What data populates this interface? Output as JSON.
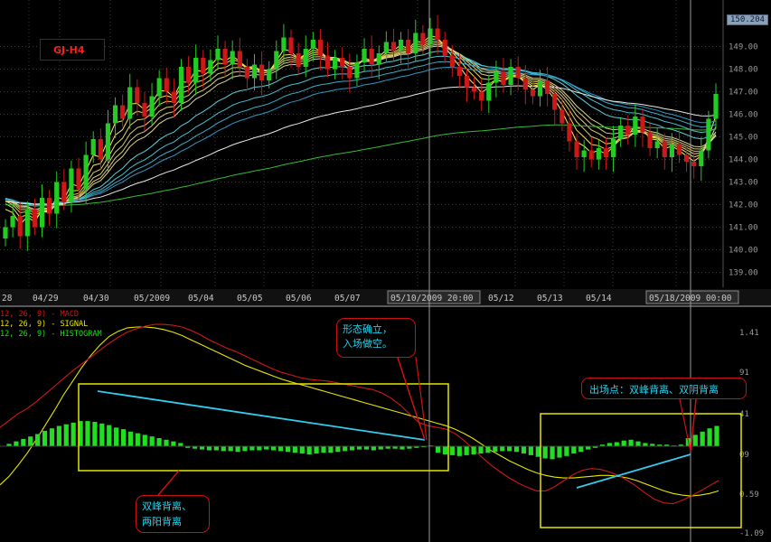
{
  "symbol_label": "GJ-H4",
  "last_price_label": "150.204",
  "price_axis": {
    "ticks": [
      "149.00",
      "148.00",
      "147.00",
      "146.00",
      "145.00",
      "144.00",
      "143.00",
      "142.00",
      "141.00",
      "140.00",
      "139.00"
    ]
  },
  "time_axis": {
    "labels": [
      "28",
      "04/29",
      "04/30",
      "05/2009",
      "05/04",
      "05/05",
      "05/06",
      "05/07",
      "05/10/2009 20:00",
      "05/12",
      "05/13",
      "05/14",
      "05/18/2009 00:00"
    ],
    "highlighted": [
      "05/10/2009 20:00",
      "05/18/2009 00:00"
    ]
  },
  "indicator": {
    "legend": [
      "12, 26, 9) - MACD",
      "12, 26, 9) - SIGNAL",
      "12, 26, 9) - HISTOGRAM"
    ],
    "legend_colors": [
      "#d01818",
      "#e6e600",
      "#22dd22"
    ],
    "axis_ticks": [
      "1.41",
      "91",
      "41",
      "09",
      "0.59",
      "-1.09"
    ]
  },
  "annotations": {
    "entry": [
      "形态确立，",
      "入场做空。"
    ],
    "exit": "出场点：双峰背离、双阴背离",
    "divergence": [
      "双峰背离、",
      "两阳背离"
    ]
  },
  "colors": {
    "up": "#22cc22",
    "down": "#cc1818",
    "grid": "#3a3a3a",
    "macd": "#d01818",
    "signal": "#e6e600",
    "hist": "#22dd22",
    "box": "#e6e600",
    "annotation_text": "#22d3ee",
    "annotation_border": "#cc1111"
  },
  "chart_data": [
    {
      "type": "candlestick",
      "title": "GJ-H4",
      "ylim": [
        138.5,
        150.9
      ],
      "x_labels": [
        "28",
        "04/29",
        "04/30",
        "05/2009",
        "05/04",
        "05/05",
        "05/06",
        "05/07",
        "05/10/2009 20:00",
        "05/12",
        "05/13",
        "05/14",
        "05/18/2009 00:00"
      ],
      "close": [
        141.0,
        141.5,
        140.6,
        141.8,
        141.0,
        142.3,
        141.6,
        143.0,
        142.1,
        143.6,
        142.7,
        144.2,
        144.9,
        144.0,
        145.6,
        146.4,
        145.8,
        147.2,
        146.5,
        145.9,
        146.8,
        147.6,
        147.0,
        146.5,
        148.1,
        147.4,
        148.5,
        147.8,
        148.4,
        148.9,
        148.2,
        148.8,
        148.1,
        147.6,
        148.2,
        147.5,
        148.0,
        148.8,
        149.4,
        148.7,
        148.1,
        148.9,
        149.3,
        148.6,
        148.0,
        148.5,
        148.1,
        147.6,
        148.3,
        148.9,
        148.2,
        148.7,
        149.2,
        148.8,
        149.3,
        148.7,
        149.6,
        149.1,
        149.8,
        149.3,
        148.6,
        148.1,
        147.7,
        147.2,
        147.0,
        146.6,
        147.4,
        147.9,
        147.3,
        148.1,
        147.6,
        147.1,
        146.8,
        147.5,
        146.9,
        146.2,
        145.6,
        144.8,
        144.1,
        144.4,
        144.0,
        144.5,
        144.1,
        144.9,
        145.5,
        145.1,
        145.9,
        145.2,
        144.5,
        144.8,
        144.1,
        144.7,
        144.2,
        143.9,
        143.7,
        144.4,
        145.8,
        146.9
      ],
      "series": [
        {
          "name": "MACD",
          "values": [
            0.22,
            0.3,
            0.38,
            0.44,
            0.52,
            0.61,
            0.7,
            0.79,
            0.88,
            0.96,
            1.04,
            1.12,
            1.2,
            1.27,
            1.33,
            1.37,
            1.4,
            1.42,
            1.42,
            1.41,
            1.39,
            1.35,
            1.3,
            1.24,
            1.19,
            1.14,
            1.1,
            1.05,
            1.0,
            0.95,
            0.9,
            0.86,
            0.83,
            0.8,
            0.78,
            0.77,
            0.76,
            0.74,
            0.72,
            0.7,
            0.68,
            0.66,
            0.62,
            0.56,
            0.48,
            0.38,
            0.28,
            0.24,
            0.22,
            0.2,
            0.15,
            0.07,
            -0.03,
            -0.13,
            -0.22,
            -0.3,
            -0.37,
            -0.43,
            -0.48,
            -0.52,
            -0.52,
            -0.47,
            -0.4,
            -0.33,
            -0.28,
            -0.26,
            -0.27,
            -0.3,
            -0.34,
            -0.4,
            -0.47,
            -0.55,
            -0.62,
            -0.66,
            -0.67,
            -0.63,
            -0.58,
            -0.52,
            -0.46,
            -0.4
          ]
        },
        {
          "name": "SIGNAL",
          "values": [
            -0.45,
            -0.35,
            -0.22,
            -0.08,
            0.08,
            0.25,
            0.42,
            0.6,
            0.76,
            0.92,
            1.06,
            1.18,
            1.28,
            1.34,
            1.38,
            1.39,
            1.39,
            1.38,
            1.36,
            1.33,
            1.29,
            1.24,
            1.19,
            1.14,
            1.09,
            1.04,
            0.99,
            0.94,
            0.9,
            0.86,
            0.82,
            0.78,
            0.75,
            0.72,
            0.69,
            0.66,
            0.63,
            0.6,
            0.57,
            0.54,
            0.51,
            0.48,
            0.45,
            0.42,
            0.39,
            0.36,
            0.33,
            0.3,
            0.27,
            0.24,
            0.2,
            0.15,
            0.09,
            0.02,
            -0.05,
            -0.11,
            -0.17,
            -0.22,
            -0.27,
            -0.31,
            -0.34,
            -0.36,
            -0.37,
            -0.37,
            -0.36,
            -0.35,
            -0.34,
            -0.34,
            -0.35,
            -0.37,
            -0.4,
            -0.44,
            -0.48,
            -0.52,
            -0.55,
            -0.57,
            -0.58,
            -0.57,
            -0.55,
            -0.52
          ]
        },
        {
          "name": "HISTOGRAM",
          "values": [
            0.03,
            0.06,
            0.09,
            0.12,
            0.15,
            0.19,
            0.22,
            0.25,
            0.27,
            0.29,
            0.31,
            0.31,
            0.3,
            0.28,
            0.26,
            0.23,
            0.21,
            0.18,
            0.16,
            0.14,
            0.12,
            0.1,
            0.08,
            0.06,
            0.04,
            -0.02,
            -0.03,
            -0.04,
            -0.05,
            -0.05,
            -0.06,
            -0.06,
            -0.07,
            -0.06,
            -0.05,
            -0.05,
            -0.04,
            -0.05,
            -0.06,
            -0.07,
            -0.08,
            -0.09,
            -0.1,
            -0.09,
            -0.08,
            -0.08,
            -0.07,
            -0.06,
            -0.05,
            -0.04,
            -0.04,
            -0.05,
            -0.04,
            -0.03,
            -0.03,
            -0.04,
            -0.03,
            -0.02,
            -0.01,
            0.01,
            -0.08,
            -0.1,
            -0.11,
            -0.12,
            -0.11,
            -0.1,
            -0.09,
            -0.08,
            -0.07,
            -0.06,
            -0.06,
            -0.07,
            -0.09,
            -0.11,
            -0.13,
            -0.15,
            -0.16,
            -0.14,
            -0.12,
            -0.09,
            -0.07,
            -0.04,
            -0.02,
            0.02,
            0.04,
            0.05,
            0.07,
            0.08,
            0.06,
            0.04,
            0.03,
            0.02,
            0.02,
            0.01,
            0.02,
            0.1,
            0.14,
            0.18,
            0.22,
            0.25
          ]
        }
      ]
    }
  ]
}
